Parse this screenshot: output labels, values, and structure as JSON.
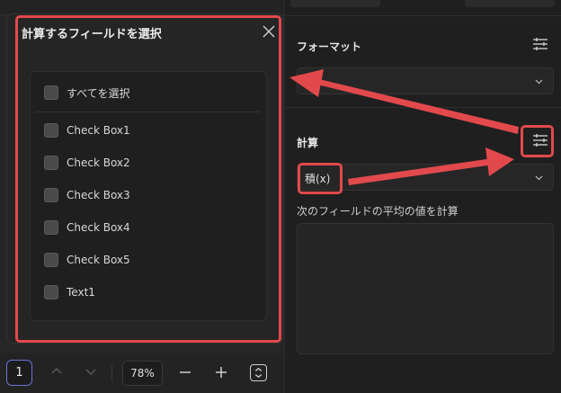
{
  "dialog": {
    "title": "計算するフィールドを選択",
    "select_all_label": "すべてを選択",
    "items": [
      {
        "label": "Check Box1",
        "checked": false
      },
      {
        "label": "Check Box2",
        "checked": false
      },
      {
        "label": "Check Box3",
        "checked": false
      },
      {
        "label": "Check Box4",
        "checked": false
      },
      {
        "label": "Check Box5",
        "checked": false
      },
      {
        "label": "Text1",
        "checked": false
      }
    ]
  },
  "toolbar": {
    "page_number": "1",
    "zoom": "78%"
  },
  "right_panel": {
    "format_title": "フォーマット",
    "format_value": "",
    "calc_title": "計算",
    "calc_value": "積(x)",
    "calc_description": "次のフィールドの平均の値を計算",
    "textarea_value": ""
  },
  "colors": {
    "highlight": "#e2494c",
    "page_border": "#6b72d6"
  },
  "icons": [
    "close-icon",
    "settings-sliders-icon",
    "chevron-down-icon",
    "chevron-up-icon",
    "minus-icon",
    "plus-icon",
    "fit-page-icon"
  ]
}
